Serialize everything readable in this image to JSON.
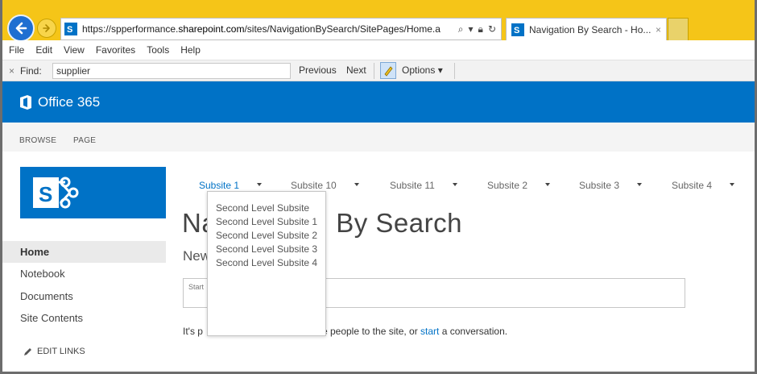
{
  "browser": {
    "url_prefix": "https://spperformance.",
    "url_domain": "sharepoint.com",
    "url_path": "/sites/NavigationBySearch/SitePages/Home.a",
    "tab_title": "Navigation By Search - Ho...",
    "tab_close": "×",
    "menu": [
      "File",
      "Edit",
      "View",
      "Favorites",
      "Tools",
      "Help"
    ]
  },
  "findbar": {
    "close": "×",
    "label": "Find:",
    "value": "supplier",
    "previous": "Previous",
    "next": "Next",
    "options": "Options"
  },
  "suite": {
    "brand": "Office 365"
  },
  "ribbon": {
    "browse": "BROWSE",
    "page": "PAGE"
  },
  "topnav": [
    {
      "label": "Subsite 1",
      "active": true
    },
    {
      "label": "Subsite 10",
      "active": false
    },
    {
      "label": "Subsite 11",
      "active": false
    },
    {
      "label": "Subsite 2",
      "active": false
    },
    {
      "label": "Subsite 3",
      "active": false
    },
    {
      "label": "Subsite 4",
      "active": false
    }
  ],
  "dropdown": {
    "items": [
      "Second Level Subsite",
      "Second Level Subsite 1",
      "Second Level Subsite 2",
      "Second Level Subsite 3",
      "Second Level Subsite 4"
    ]
  },
  "leftnav": {
    "items": [
      "Home",
      "Notebook",
      "Documents",
      "Site Contents"
    ],
    "edit_links": "EDIT LINKS"
  },
  "page": {
    "title_left": "Na",
    "title_right": "By Search",
    "newsfeed_partial": "New",
    "post_placeholder_partial": "Start",
    "empty_left": "It's p",
    "empty_mid": "re people to the site, or ",
    "empty_link": "start",
    "empty_right": " a conversation."
  },
  "colors": {
    "suite_blue": "#0072c6",
    "browser_yellow": "#f5c518"
  }
}
